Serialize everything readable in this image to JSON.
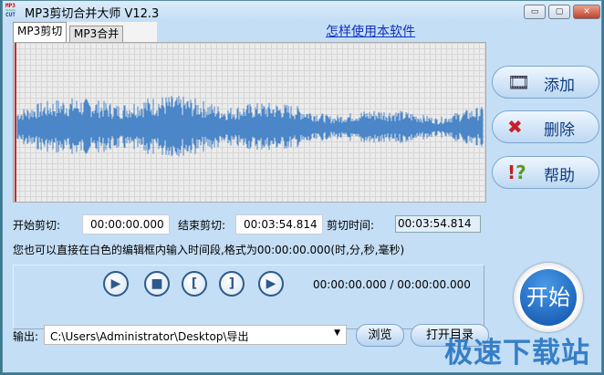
{
  "window": {
    "title": "MP3剪切合并大师 V12.3",
    "logo": "MP3 CUT",
    "minimize": "▭",
    "maximize": "▢",
    "close": "✕"
  },
  "tabs": [
    {
      "label": "MP3剪切"
    },
    {
      "label": "MP3合并"
    }
  ],
  "help_link": "怎样使用本软件",
  "side_buttons": [
    {
      "label": "添加",
      "icon": "add-film-icon"
    },
    {
      "label": "删除",
      "icon": "delete-x-icon"
    },
    {
      "label": "帮助",
      "icon": "help-icon"
    }
  ],
  "cut": {
    "start_label": "开始剪切:",
    "start_value": "00:00:00.000",
    "end_label": "结束剪切:",
    "end_value": "00:03:54.814",
    "duration_label": "剪切时间:",
    "duration_value": "00:03:54.814"
  },
  "hint": "您也可以直接在白色的编辑框内输入时间段,格式为00:00:00.000(时,分,秒,毫秒)",
  "player": {
    "time": "00:00:00.000 / 00:00:00.000",
    "buttons": [
      "play-icon",
      "stop-icon",
      "mark-start-icon",
      "mark-end-icon",
      "play-selection-icon"
    ]
  },
  "start_button": "开始",
  "output": {
    "label": "输出:",
    "path": "C:\\Users\\Administrator\\Desktop\\导出",
    "browse": "浏览",
    "open_dir": "打开目录"
  },
  "watermark": "极速下载站",
  "colors": {
    "waveform": "#4a86c8",
    "marker": "#c0302a",
    "background": "#c4def5"
  }
}
